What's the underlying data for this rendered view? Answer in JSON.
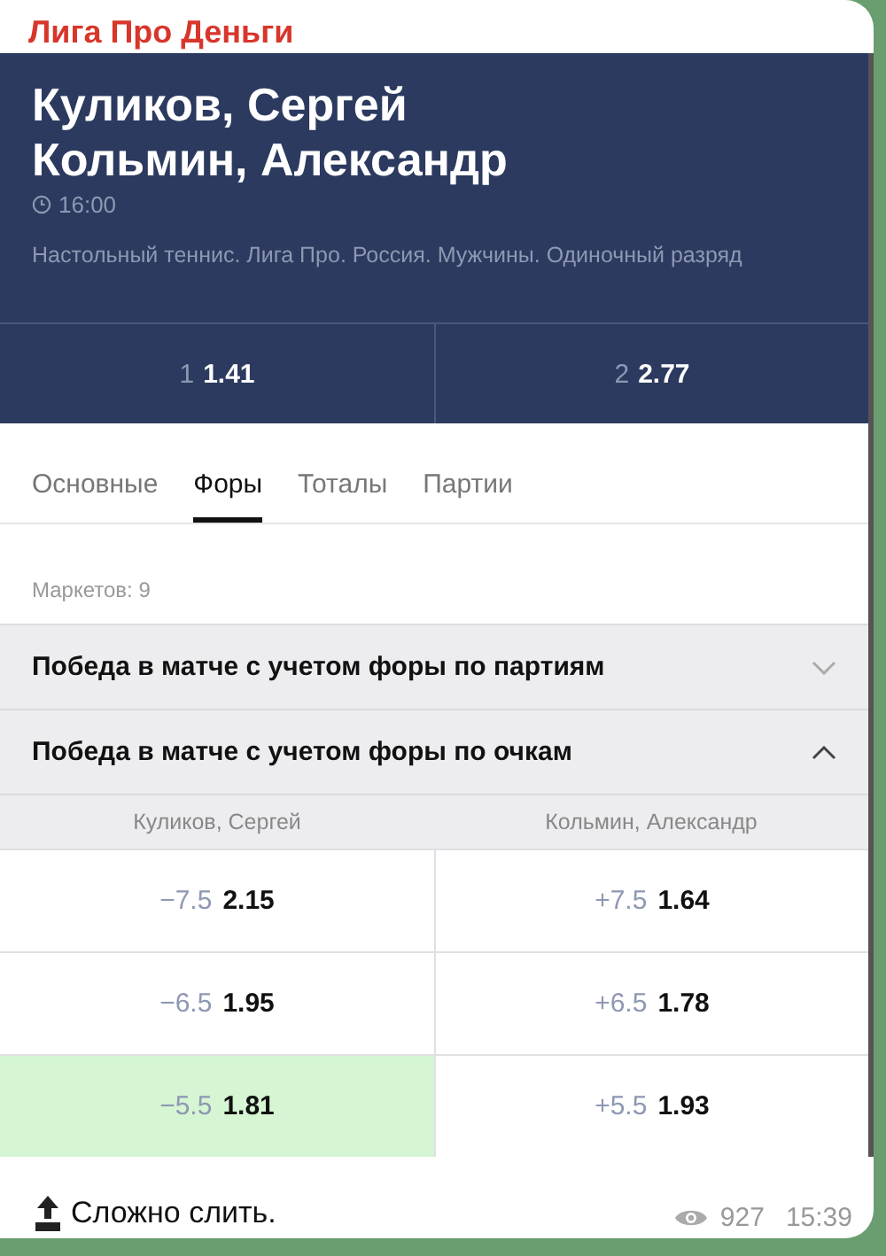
{
  "channel": {
    "name": "Лига Про Деньги"
  },
  "event": {
    "players": [
      "Куликов, Сергей",
      "Кольмин, Александр"
    ],
    "time": "16:00",
    "category": "Настольный теннис. Лига Про. Россия. Мужчины. Одиночный разряд"
  },
  "main_odds": [
    {
      "label": "1",
      "odds": "1.41"
    },
    {
      "label": "2",
      "odds": "2.77"
    }
  ],
  "tabs": [
    {
      "label": "Основные",
      "selected": false
    },
    {
      "label": "Форы",
      "selected": true
    },
    {
      "label": "Тоталы",
      "selected": false
    },
    {
      "label": "Партии",
      "selected": false
    }
  ],
  "markets_count": "Маркетов: 9",
  "markets": [
    {
      "title": "Победа в матче с учетом форы по партиям",
      "expanded": false
    },
    {
      "title": "Победа в матче с учетом форы по очкам",
      "expanded": true
    }
  ],
  "table": {
    "columns": [
      "Куликов, Сергей",
      "Кольмин, Александр"
    ],
    "rows": [
      [
        {
          "handicap": "−7.5",
          "odds": "2.15",
          "selected": false
        },
        {
          "handicap": "+7.5",
          "odds": "1.64",
          "selected": false
        }
      ],
      [
        {
          "handicap": "−6.5",
          "odds": "1.95",
          "selected": false
        },
        {
          "handicap": "+6.5",
          "odds": "1.78",
          "selected": false
        }
      ],
      [
        {
          "handicap": "−5.5",
          "odds": "1.81",
          "selected": true
        },
        {
          "handicap": "+5.5",
          "odds": "1.93",
          "selected": false
        }
      ]
    ]
  },
  "caption": "Сложно слить.",
  "views": "927",
  "time": "15:39"
}
